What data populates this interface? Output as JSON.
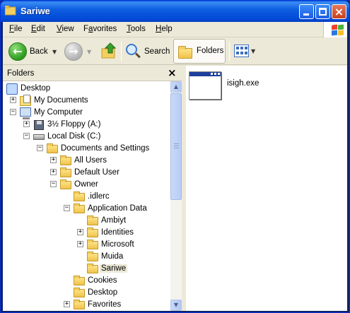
{
  "window": {
    "title": "Sariwe",
    "controls": {
      "minimize": "minimize",
      "maximize": "maximize",
      "close": "×"
    }
  },
  "menu": [
    {
      "accel": "F",
      "rest": "ile"
    },
    {
      "accel": "E",
      "rest": "dit"
    },
    {
      "accel": "V",
      "rest": "iew"
    },
    {
      "accel": "",
      "pre": "F",
      "accel2": "a",
      "rest": "vorites"
    },
    {
      "accel": "T",
      "rest": "ools"
    },
    {
      "accel": "H",
      "rest": "elp"
    }
  ],
  "toolbar": {
    "back_label": "Back",
    "search_label": "Search",
    "folders_label": "Folders"
  },
  "panel": {
    "title": "Folders",
    "close_glyph": "×",
    "tree": [
      {
        "label": "Desktop",
        "icon": "desktop-icon",
        "expander": ""
      },
      {
        "label": "My Documents",
        "icon": "my-documents-icon",
        "expander": "+"
      },
      {
        "label": "My Computer",
        "icon": "my-computer-icon",
        "expander": "−"
      },
      {
        "label": "3½ Floppy (A:)",
        "icon": "floppy-drive-icon",
        "expander": "+"
      },
      {
        "label": "Local Disk (C:)",
        "icon": "hard-disk-icon",
        "expander": "−"
      },
      {
        "label": "Documents and Settings",
        "icon": "folder-icon",
        "expander": "−"
      },
      {
        "label": "All Users",
        "icon": "folder-icon",
        "expander": "+"
      },
      {
        "label": "Default User",
        "icon": "folder-icon",
        "expander": "+"
      },
      {
        "label": "Owner",
        "icon": "folder-icon",
        "expander": "−"
      },
      {
        "label": ".idlerc",
        "icon": "folder-icon",
        "expander": ""
      },
      {
        "label": "Application Data",
        "icon": "folder-icon",
        "expander": "−"
      },
      {
        "label": "Ambiyt",
        "icon": "folder-icon",
        "expander": ""
      },
      {
        "label": "Identities",
        "icon": "folder-icon",
        "expander": "+"
      },
      {
        "label": "Microsoft",
        "icon": "folder-icon",
        "expander": "+"
      },
      {
        "label": "Muida",
        "icon": "folder-icon",
        "expander": ""
      },
      {
        "label": "Sariwe",
        "icon": "open-folder-icon",
        "expander": "",
        "selected": true
      },
      {
        "label": "Cookies",
        "icon": "folder-icon",
        "expander": ""
      },
      {
        "label": "Desktop",
        "icon": "folder-icon",
        "expander": ""
      },
      {
        "label": "Favorites",
        "icon": "folder-icon",
        "expander": "+"
      }
    ]
  },
  "content": {
    "files": [
      {
        "name": "isigh.exe",
        "icon": "application-exe-icon"
      }
    ]
  },
  "colors": {
    "titlebar": "#0a5fd8",
    "frame": "#ece9d8",
    "selection": "#ece9d8"
  }
}
